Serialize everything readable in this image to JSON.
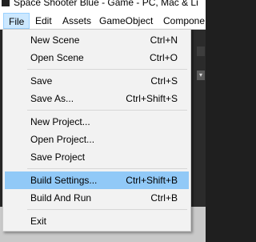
{
  "window": {
    "title": "Space Shooter Blue - Game - PC, Mac & Li"
  },
  "menubar": {
    "items": [
      "File",
      "Edit",
      "Assets",
      "GameObject",
      "Compone"
    ]
  },
  "file_menu": {
    "items": [
      {
        "label": "New Scene",
        "shortcut": "Ctrl+N"
      },
      {
        "label": "Open Scene",
        "shortcut": "Ctrl+O"
      },
      {
        "label": "Save",
        "shortcut": "Ctrl+S"
      },
      {
        "label": "Save As...",
        "shortcut": "Ctrl+Shift+S"
      },
      {
        "label": "New Project...",
        "shortcut": ""
      },
      {
        "label": "Open Project...",
        "shortcut": ""
      },
      {
        "label": "Save Project",
        "shortcut": ""
      },
      {
        "label": "Build Settings...",
        "shortcut": "Ctrl+Shift+B"
      },
      {
        "label": "Build And Run",
        "shortcut": "Ctrl+B"
      },
      {
        "label": "Exit",
        "shortcut": ""
      }
    ],
    "highlighted": "Build Settings..."
  },
  "colors": {
    "highlight": "#91c9f7",
    "active_menu": "#cce8ff"
  }
}
